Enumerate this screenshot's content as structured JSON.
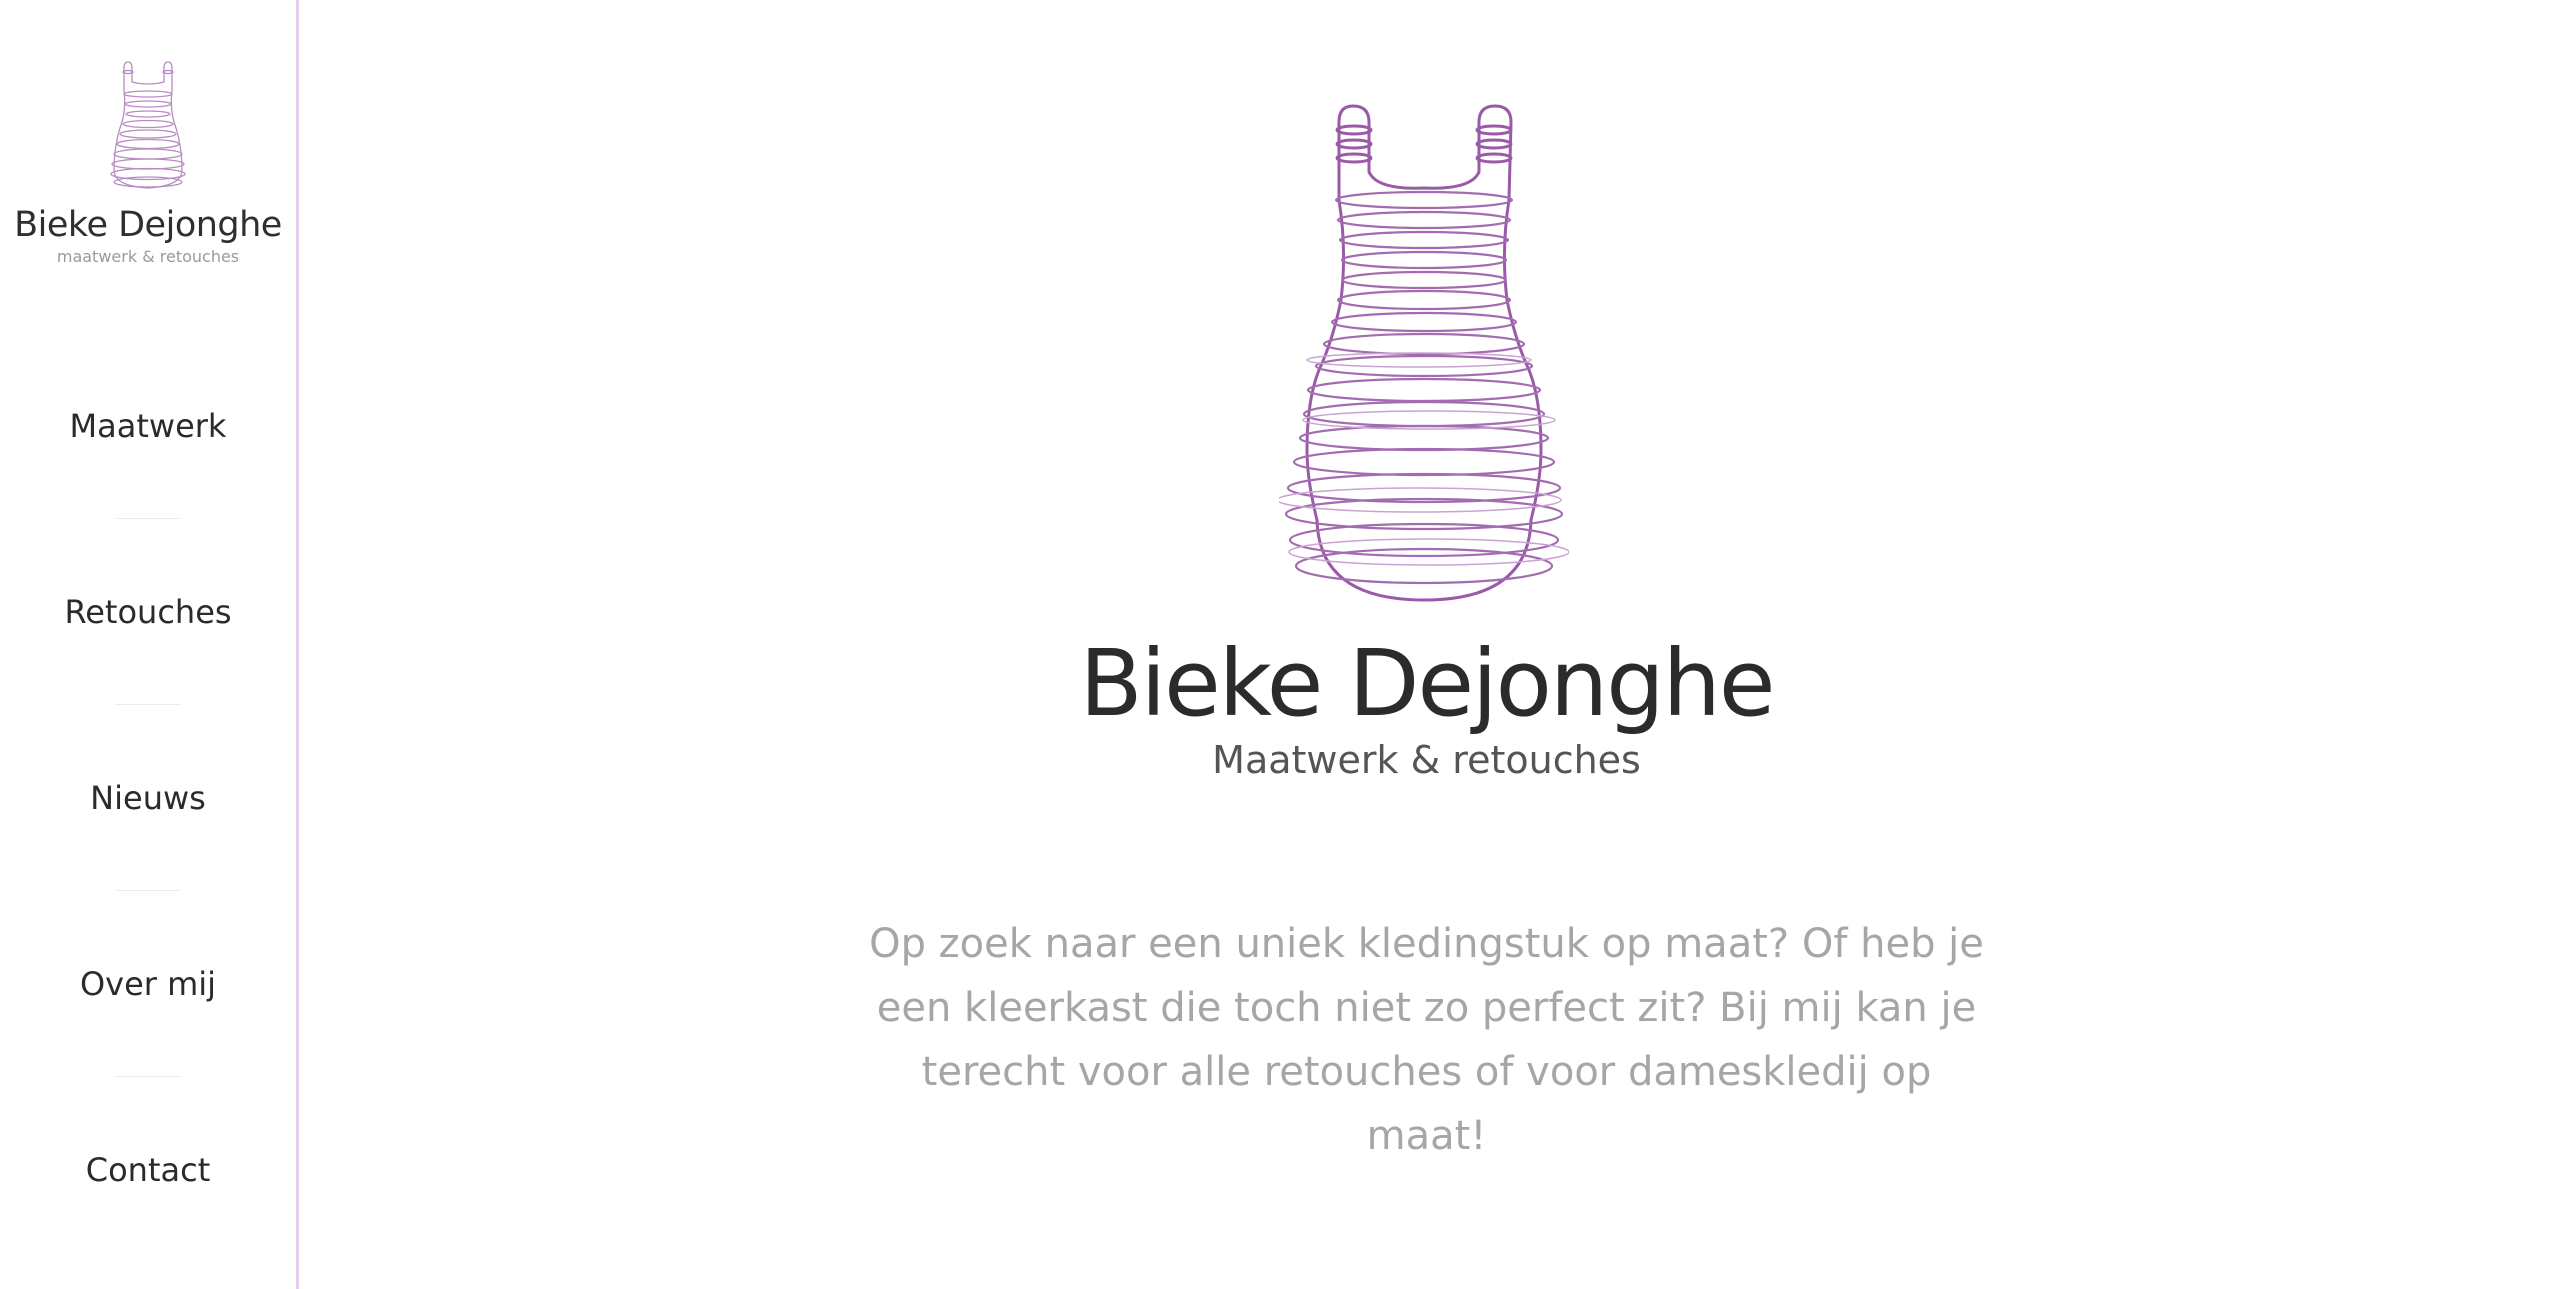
{
  "brand": {
    "name": "Bieke Dejonghe",
    "tagline_small": "maatwerk & retouches",
    "tagline": "Maatwerk & retouches",
    "accent_color": "#9b5aa8",
    "logo_icon": "dress-icon"
  },
  "nav": {
    "items": [
      {
        "label": "Maatwerk"
      },
      {
        "label": "Retouches"
      },
      {
        "label": "Nieuws"
      },
      {
        "label": "Over mij"
      },
      {
        "label": "Contact"
      }
    ]
  },
  "hero": {
    "title": "Bieke Dejonghe",
    "subtitle": "Maatwerk & retouches",
    "intro": "Op zoek naar een uniek kledingstuk op maat? Of heb je een kleerkast die toch niet zo perfect zit? Bij mij kan je terecht voor alle retouches of voor dameskledij op maat!"
  }
}
